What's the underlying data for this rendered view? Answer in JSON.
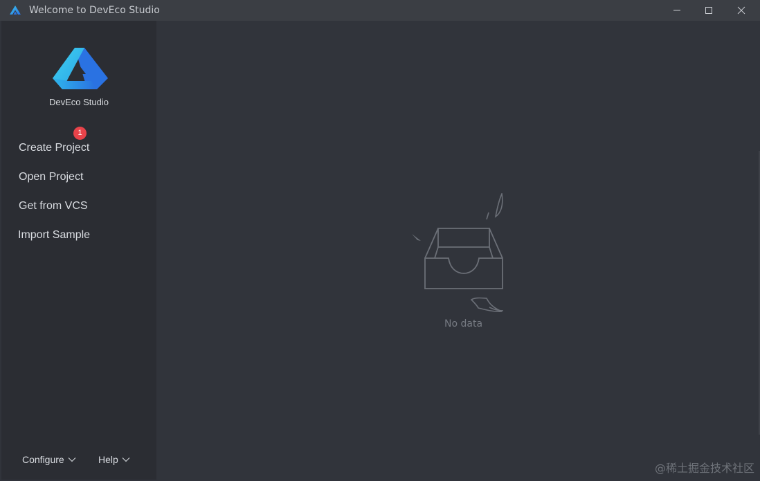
{
  "window": {
    "title": "Welcome to DevEco Studio",
    "controls": {
      "minimize": "minimize",
      "maximize": "maximize",
      "close": "close"
    }
  },
  "sidebar": {
    "brand": "DevEco Studio",
    "badge_count": "1",
    "items": [
      {
        "label": "Create Project"
      },
      {
        "label": "Open Project"
      },
      {
        "label": "Get from VCS"
      },
      {
        "label": "Import Sample"
      }
    ],
    "footer": {
      "configure_label": "Configure",
      "help_label": "Help"
    }
  },
  "main": {
    "empty_state_text": "No data"
  },
  "watermark": "@稀土掘金技术社区",
  "colors": {
    "accent_badge": "#e8434a",
    "sidebar_bg": "#2b2d33",
    "main_bg": "#31343b"
  },
  "icons": {
    "app": "deveco-logo-icon",
    "empty": "empty-inbox-icon",
    "dropdown": "chevron-down-icon"
  }
}
